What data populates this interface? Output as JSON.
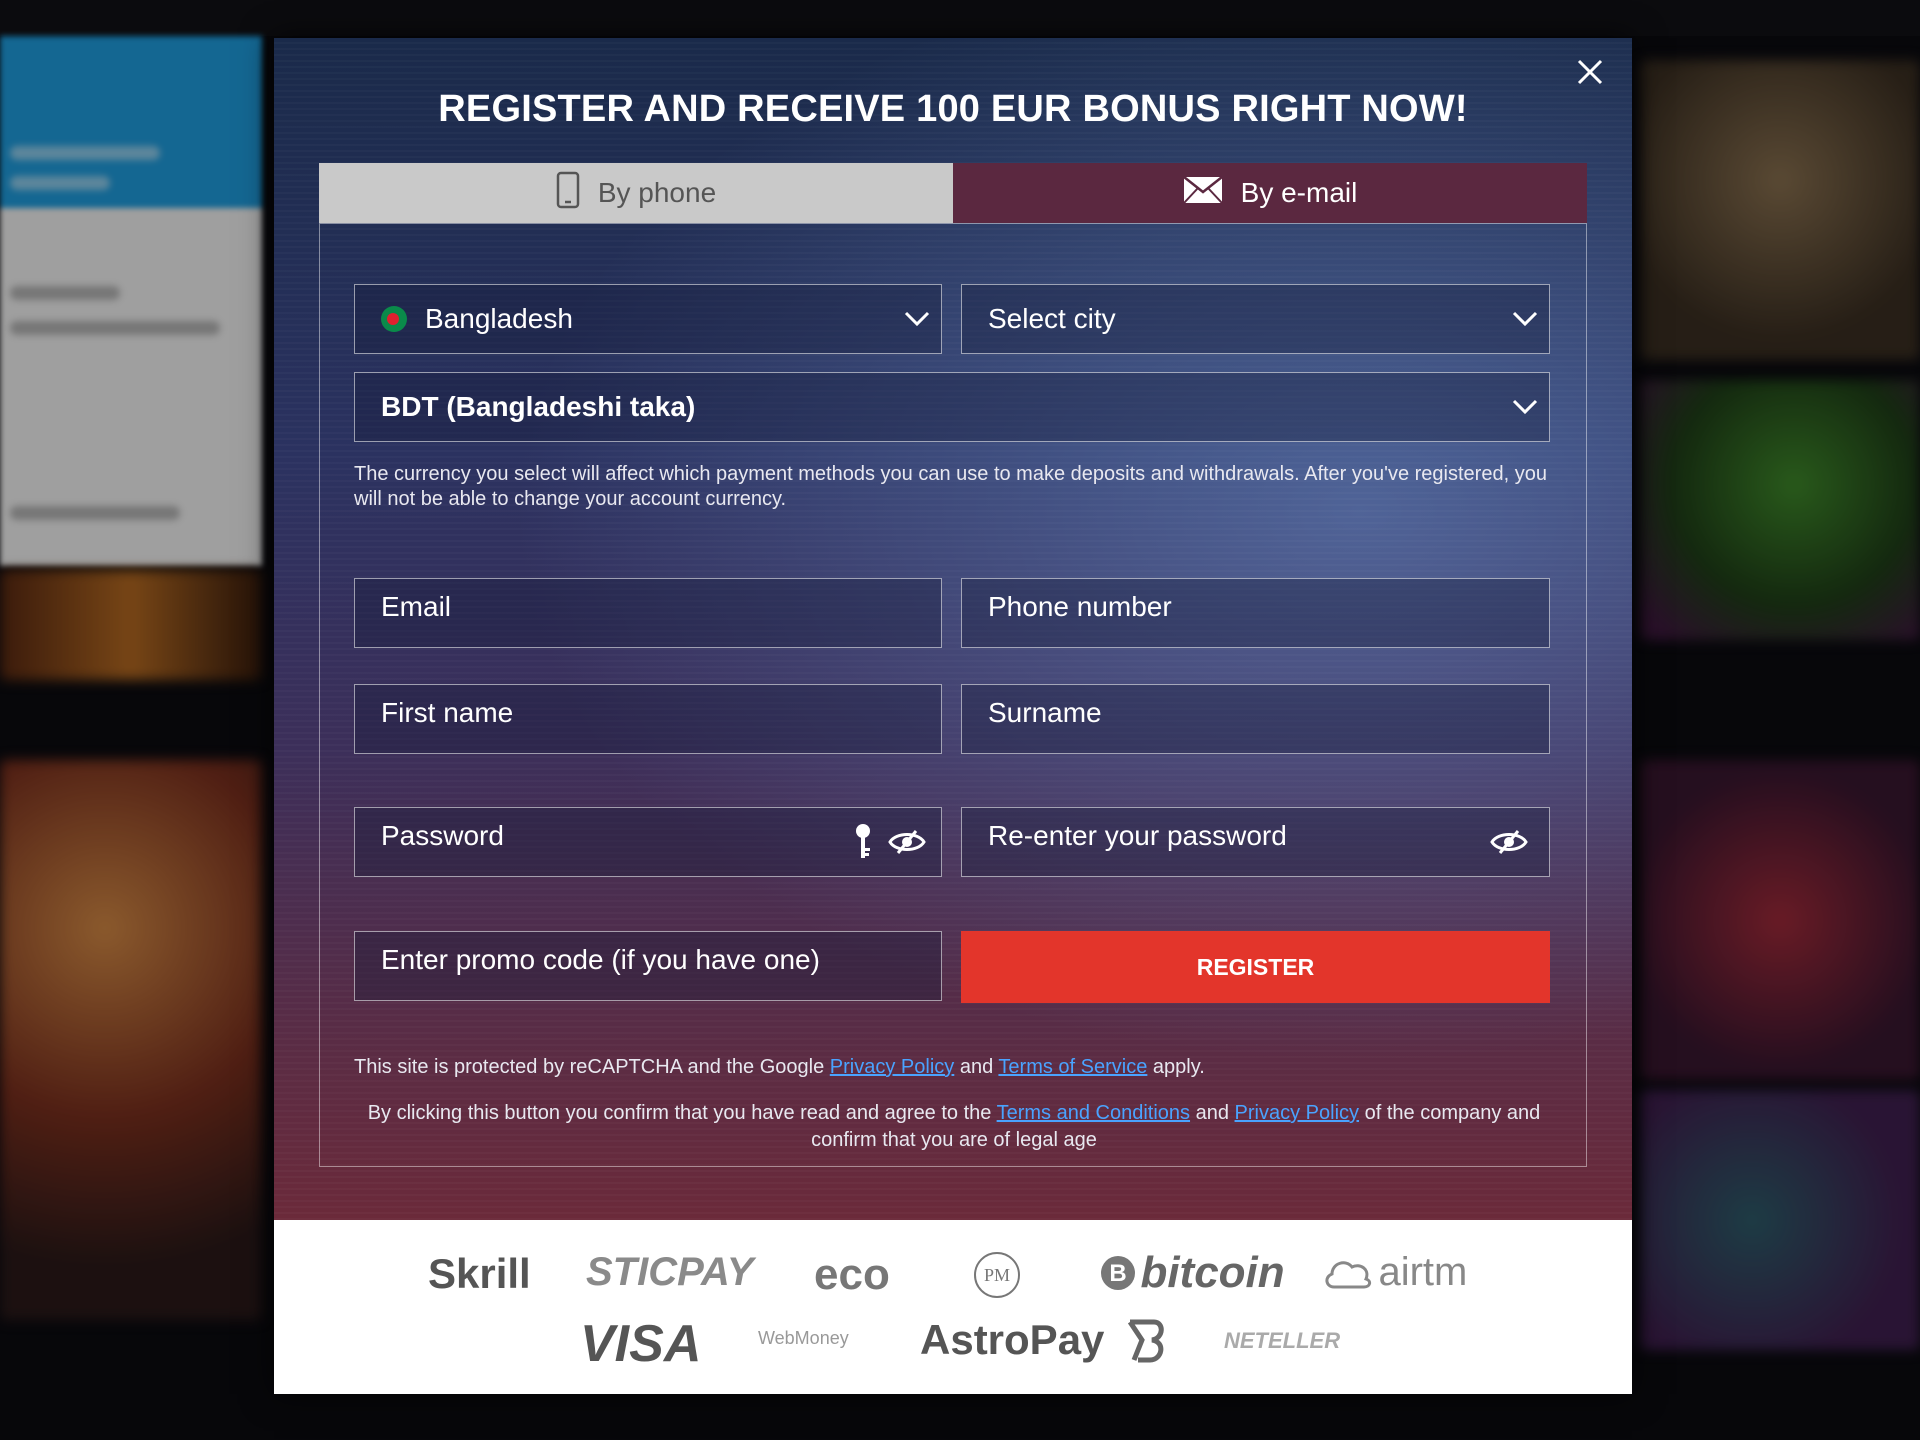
{
  "modal": {
    "title": "REGISTER AND RECEIVE 100 EUR BONUS RIGHT NOW!",
    "close_icon": "×"
  },
  "tabs": [
    {
      "label": "By phone",
      "icon": "phone-icon",
      "active": false
    },
    {
      "label": "By e-mail",
      "icon": "envelope-icon",
      "active": true
    }
  ],
  "form": {
    "country": "Bangladesh",
    "city_placeholder": "Select city",
    "currency": "BDT (Bangladeshi taka)",
    "currency_note": "The currency you select will affect which payment methods you can use to make deposits and withdrawals. After you've registered, you will not be able to change your account currency.",
    "email_placeholder": "Email",
    "phone_placeholder": "Phone number",
    "first_name_placeholder": "First name",
    "surname_placeholder": "Surname",
    "password_placeholder": "Password",
    "reenter_password_placeholder": "Re-enter your password",
    "promo_placeholder": "Enter promo code (if you have one)",
    "register_label": "REGISTER"
  },
  "legal": {
    "recaptcha_prefix": "This site is protected by reCAPTCHA and the Google",
    "privacy_policy": "Privacy Policy",
    "and": "and",
    "terms_of_service": "Terms of Service",
    "apply": "apply.",
    "consent_prefix": "By clicking this button you confirm that you have read and agree to the",
    "terms_and_conditions": "Terms and Conditions",
    "and2": "and",
    "privacy_policy2": "Privacy Policy",
    "consent_suffix": "of the company and confirm that you are of legal age"
  },
  "payments": {
    "row1": [
      "Skrill",
      "STICPAY",
      "eco",
      "PM",
      "bitcoin",
      "airtm"
    ],
    "row2": [
      "VISA",
      "WebMoney",
      "AstroPay",
      "NETELLER"
    ]
  },
  "colors": {
    "register": "#e3352b",
    "tab_active": "#5b2840",
    "tab_inactive": "#c9c9c9",
    "link": "#4aa3ff"
  }
}
